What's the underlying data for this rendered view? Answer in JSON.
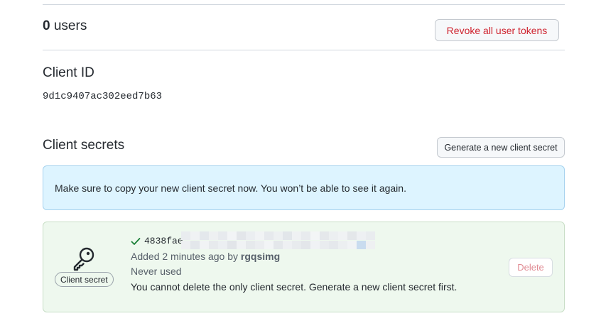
{
  "users": {
    "count": "0",
    "label": "users",
    "revoke_button": "Revoke all user tokens"
  },
  "client_id": {
    "title": "Client ID",
    "value": "9d1c9407ac302eed7b63"
  },
  "client_secrets": {
    "title": "Client secrets",
    "generate_button": "Generate a new client secret",
    "flash_message": "Make sure to copy your new client secret now. You won’t be able to see it again.",
    "secret": {
      "label": "Client secret",
      "value_prefix": "4838fae",
      "added_prefix": "Added 2 minutes ago by",
      "added_by": "rgqsimg",
      "usage": "Never used",
      "note": "You cannot delete the only client secret. Generate a new client secret first.",
      "delete_button": "Delete"
    }
  },
  "colors": {
    "danger": "#cf222e",
    "flash_bg": "#ddf4ff",
    "success_bg": "#eef8ee",
    "success_icon": "#1a7f37"
  },
  "icons": [
    "key-icon",
    "check-icon"
  ]
}
